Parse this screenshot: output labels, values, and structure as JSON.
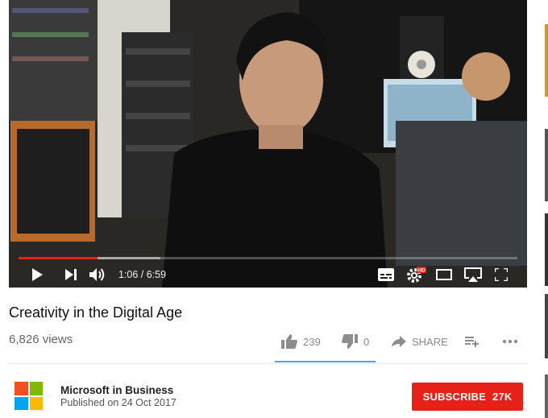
{
  "player": {
    "time_label": "1:06 / 6:59",
    "progress_fraction": 0.158,
    "buffer_fraction": 0.285,
    "controls": [
      "play-icon",
      "next-icon",
      "volume-icon",
      "subtitles-icon",
      "settings-hd-icon",
      "theater-mode-icon",
      "airplay-icon",
      "fullscreen-icon"
    ],
    "hd_badge": "HD"
  },
  "video": {
    "title": "Creativity in the Digital Age",
    "views": "6,826 views"
  },
  "actions": {
    "like_count": "239",
    "dislike_count": "0",
    "share_label": "SHARE"
  },
  "channel": {
    "name": "Microsoft in Business",
    "published": "Published on 24 Oct 2017",
    "logo_colors": [
      "#f25022",
      "#7fba00",
      "#00a4ef",
      "#ffb900"
    ]
  },
  "subscribe": {
    "label": "SUBSCRIBE",
    "count": "27K",
    "color": "#e62117"
  }
}
